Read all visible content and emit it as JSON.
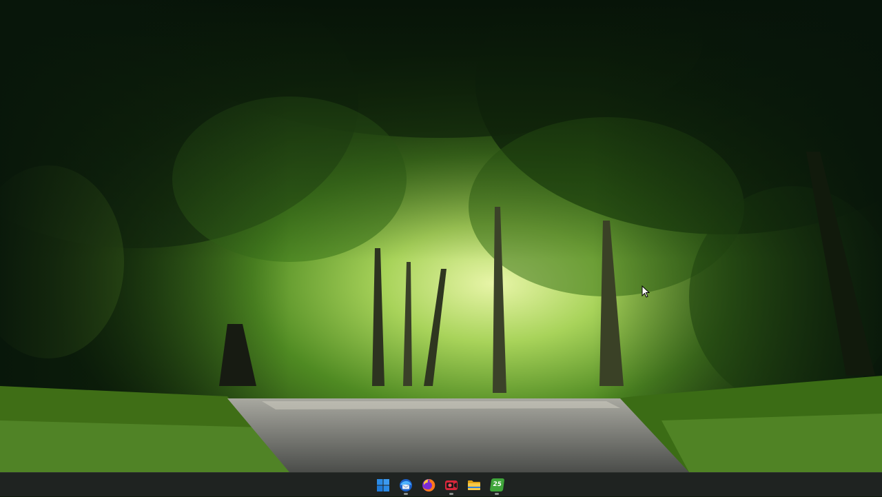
{
  "desktop": {
    "wallpaper": "forest-road-wallpaper"
  },
  "colors": {
    "taskbar_bg": "#1f2321",
    "start_blue": "#2b8be6",
    "running_indicator": "#8a8f8c"
  },
  "taskbar": {
    "items": [
      {
        "name": "start-button",
        "icon": "windows-logo-icon",
        "running": false
      },
      {
        "name": "thunderbird-button",
        "icon": "thunderbird-icon",
        "running": true
      },
      {
        "name": "firefox-button",
        "icon": "firefox-icon",
        "running": false
      },
      {
        "name": "screen-recorder-button",
        "icon": "record-camera-icon",
        "running": true
      },
      {
        "name": "file-explorer-button",
        "icon": "folder-icon",
        "running": false
      },
      {
        "name": "app-25-button",
        "icon": "app-25-icon",
        "badge_text": "25",
        "running": true
      }
    ]
  }
}
